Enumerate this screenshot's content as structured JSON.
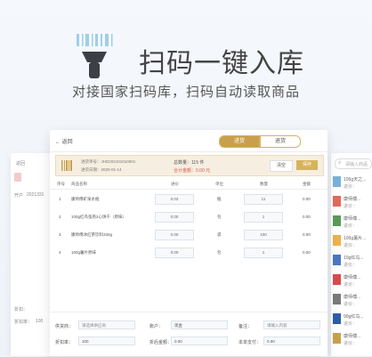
{
  "hero": {
    "title": "扫码一键入库",
    "subtitle": "对接国家扫码库，扫码自动读取商品"
  },
  "left_panel": {
    "back_label": "返回",
    "field1": "开户",
    "field1_value": "2021331",
    "field2": "折扣：",
    "field2_value": "100",
    "field3": "折扣率：",
    "field3_value": "100"
  },
  "main": {
    "back_label": "返回",
    "tabs": [
      {
        "label": "进货"
      },
      {
        "label": "退货"
      }
    ],
    "info": {
      "order_no": "进货单号：JHD202101010001",
      "order_date": "进货日期：2020-01-14",
      "total_count": "总数量：115 件",
      "total_amount": "合计金额：0.00 元",
      "clear_label": "清空",
      "save_label": "保存"
    },
    "table": {
      "headers": [
        "序号",
        "商品名称",
        "进价",
        "单位",
        "数量",
        "金额"
      ],
      "rows": [
        {
          "no": "1",
          "name": "康师傅矿泉水瓶",
          "price": "0.02",
          "unit": "瓶",
          "qty": "11",
          "amount": "0.00"
        },
        {
          "no": "2",
          "name": "100g红鸟弦卷2心饼干（原味）",
          "price": "0.00",
          "unit": "包",
          "qty": "1",
          "amount": "0.00"
        },
        {
          "no": "3",
          "name": "康师傅冰红茶饮料330g",
          "price": "0.00",
          "unit": "袋",
          "qty": "100",
          "amount": "0.00"
        },
        {
          "no": "4",
          "name": "100g薯片原味",
          "price": "0.00",
          "unit": "包",
          "qty": "1",
          "amount": "0.00"
        }
      ]
    },
    "footer": {
      "supplier_label": "供货商：",
      "supplier_placeholder": "请选择供应商",
      "account_label": "账户：",
      "account_value": "现金",
      "remark_label": "备注：",
      "remark_placeholder": "请输入内容",
      "discount_label": "折扣率：",
      "discount_value": "100",
      "discount_amount_label": "折后金额：",
      "discount_amount_value": "0.00",
      "paid_label": "本单支付：",
      "paid_value": "0.00"
    }
  },
  "right_panel": {
    "search_placeholder": "请输入商品",
    "items": [
      {
        "name": "105g天之..."
      },
      {
        "name": "康师傅..."
      },
      {
        "name": "康师傅..."
      },
      {
        "name": "100g薯片..."
      },
      {
        "name": "10g红鸟..."
      },
      {
        "name": "康师傅..."
      },
      {
        "name": "康师傅..."
      },
      {
        "name": "90g红鸟..."
      },
      {
        "name": "康师傅..."
      }
    ],
    "price_label": "进价："
  }
}
